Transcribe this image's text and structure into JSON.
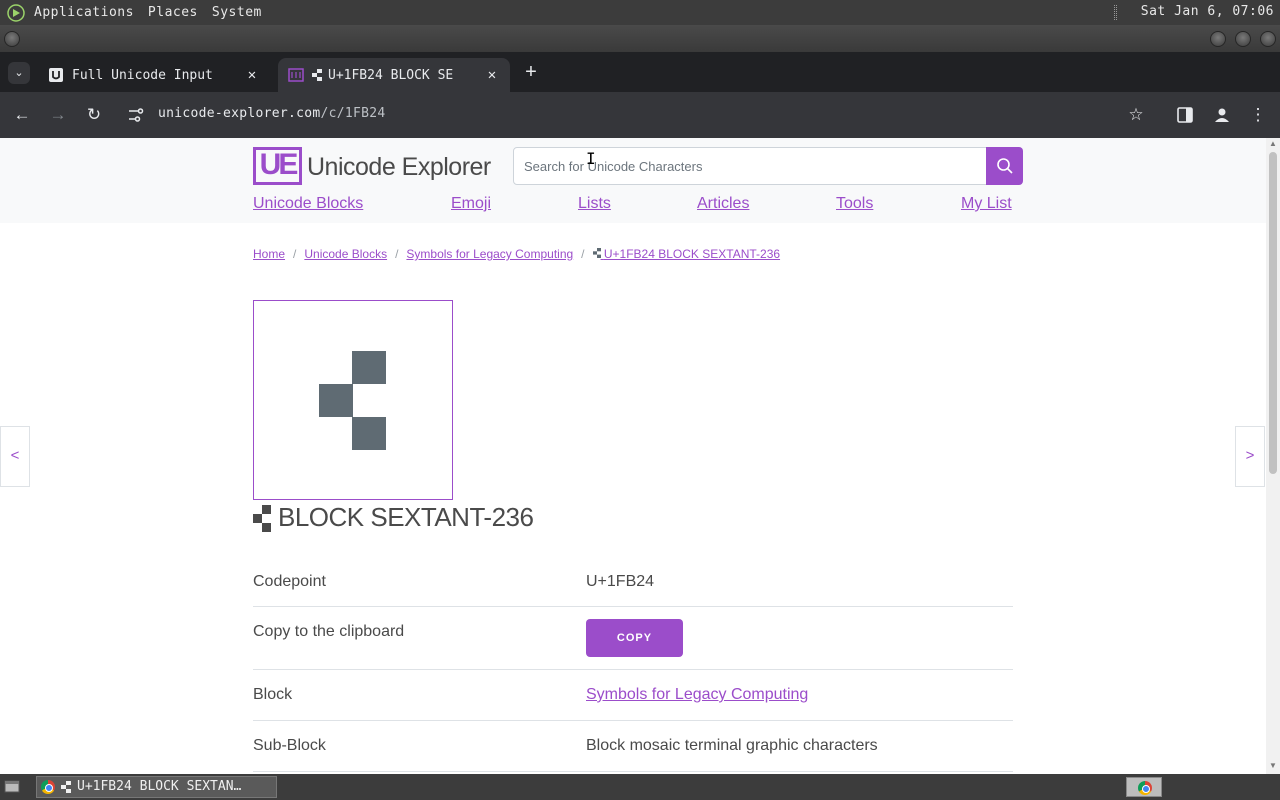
{
  "top_panel": {
    "menus": [
      "Applications",
      "Places",
      "System"
    ],
    "clock": "Sat Jan  6, 07:06"
  },
  "browser": {
    "tabs": [
      {
        "title": "Full Unicode Input",
        "favicon": "unicode-input-icon",
        "active": false
      },
      {
        "title": "U+1FB24 BLOCK SE",
        "favicon": "unicode-explorer-icon",
        "active": true
      }
    ],
    "new_tab_label": "+",
    "url_host": "unicode-explorer.com",
    "url_path": "/c/1FB24"
  },
  "site": {
    "logo_mark": "UE",
    "logo_text": "Unicode Explorer",
    "search_placeholder": "Search for Unicode Characters",
    "nav": [
      "Unicode Blocks",
      "Emoji",
      "Lists",
      "Articles",
      "Tools",
      "My List"
    ],
    "accent_color": "#9b4dca"
  },
  "breadcrumb": {
    "home": "Home",
    "blocks": "Unicode Blocks",
    "block": "Symbols for Legacy Computing",
    "current": "U+1FB24 BLOCK SEXTANT-236"
  },
  "character": {
    "name": "BLOCK SEXTANT-236",
    "glyph_cells": [
      "row1-right",
      "row2-left",
      "row3-right"
    ]
  },
  "properties": [
    {
      "key": "Codepoint",
      "value": "U+1FB24"
    },
    {
      "key": "Copy to the clipboard",
      "button": "COPY"
    },
    {
      "key": "Block",
      "link": "Symbols for Legacy Computing"
    },
    {
      "key": "Sub-Block",
      "value": "Block mosaic terminal graphic characters"
    }
  ],
  "pager": {
    "prev": "<",
    "next": ">"
  },
  "taskbar": {
    "window_title": "U+1FB24 BLOCK SEXTAN…"
  }
}
